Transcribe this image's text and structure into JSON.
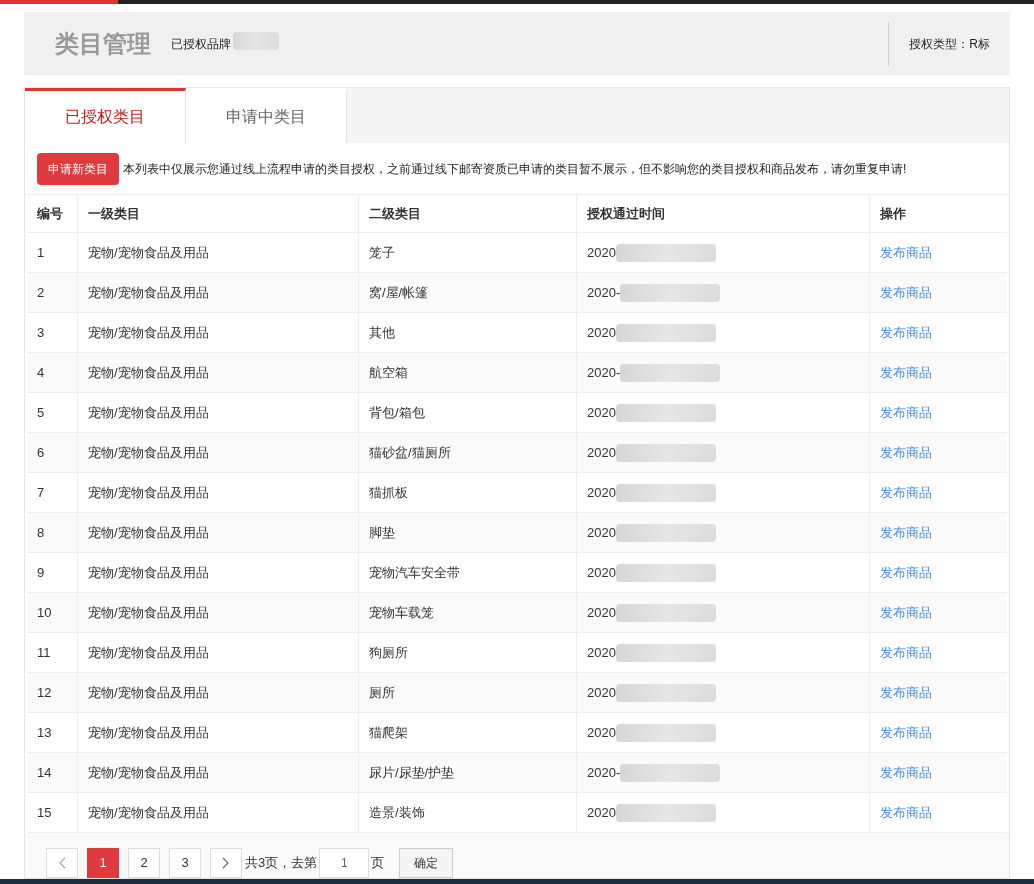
{
  "header": {
    "title": "类目管理",
    "brand_label": "已授权品牌",
    "auth_type": "授权类型：R标"
  },
  "tabs": [
    {
      "label": "已授权类目",
      "selected": true
    },
    {
      "label": "申请中类目",
      "selected": false
    }
  ],
  "apply_button": "申请新类目",
  "notice": "本列表中仅展示您通过线上流程申请的类目授权，之前通过线下邮寄资质已申请的类目暂不展示，但不影响您的类目授权和商品发布，请勿重复申请!",
  "table": {
    "columns": [
      "编号",
      "一级类目",
      "二级类目",
      "授权通过时间",
      "操作"
    ],
    "rows": [
      {
        "no": "1",
        "level1": "宠物/宠物食品及用品",
        "level2": "笼子",
        "time": "2020",
        "action": "发布商品"
      },
      {
        "no": "2",
        "level1": "宠物/宠物食品及用品",
        "level2": "窝/屋/帐篷",
        "time": "2020-",
        "action": "发布商品"
      },
      {
        "no": "3",
        "level1": "宠物/宠物食品及用品",
        "level2": "其他",
        "time": "2020",
        "action": "发布商品"
      },
      {
        "no": "4",
        "level1": "宠物/宠物食品及用品",
        "level2": "航空箱",
        "time": "2020-",
        "action": "发布商品"
      },
      {
        "no": "5",
        "level1": "宠物/宠物食品及用品",
        "level2": "背包/箱包",
        "time": "2020",
        "action": "发布商品"
      },
      {
        "no": "6",
        "level1": "宠物/宠物食品及用品",
        "level2": "猫砂盆/猫厕所",
        "time": "2020",
        "action": "发布商品"
      },
      {
        "no": "7",
        "level1": "宠物/宠物食品及用品",
        "level2": "猫抓板",
        "time": "2020",
        "action": "发布商品"
      },
      {
        "no": "8",
        "level1": "宠物/宠物食品及用品",
        "level2": "脚垫",
        "time": "2020",
        "action": "发布商品"
      },
      {
        "no": "9",
        "level1": "宠物/宠物食品及用品",
        "level2": "宠物汽车安全带",
        "time": "2020",
        "action": "发布商品"
      },
      {
        "no": "10",
        "level1": "宠物/宠物食品及用品",
        "level2": "宠物车载笼",
        "time": "2020",
        "action": "发布商品"
      },
      {
        "no": "11",
        "level1": "宠物/宠物食品及用品",
        "level2": "狗厕所",
        "time": "2020",
        "action": "发布商品"
      },
      {
        "no": "12",
        "level1": "宠物/宠物食品及用品",
        "level2": "厕所",
        "time": "2020",
        "action": "发布商品"
      },
      {
        "no": "13",
        "level1": "宠物/宠物食品及用品",
        "level2": "猫爬架",
        "time": "2020",
        "action": "发布商品"
      },
      {
        "no": "14",
        "level1": "宠物/宠物食品及用品",
        "level2": "尿片/尿垫/护垫",
        "time": "2020-",
        "action": "发布商品"
      },
      {
        "no": "15",
        "level1": "宠物/宠物食品及用品",
        "level2": "造景/装饰",
        "time": "2020",
        "action": "发布商品"
      }
    ]
  },
  "pagination": {
    "pages": [
      {
        "label": "1",
        "selected": true
      },
      {
        "label": "2",
        "selected": false
      },
      {
        "label": "3",
        "selected": false
      }
    ],
    "total": "共3页，去第",
    "page_input": "1",
    "page_suffix": "页",
    "confirm": "确定"
  }
}
